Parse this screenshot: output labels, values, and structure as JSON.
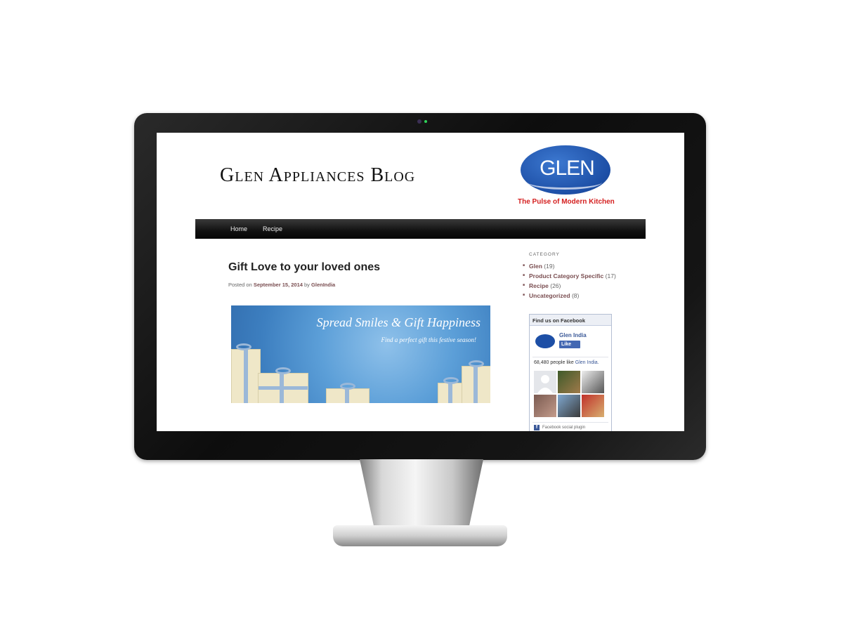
{
  "site": {
    "title": "Glen Appliances Blog",
    "logo_text": "GLEN",
    "tagline": "The Pulse of Modern Kitchen"
  },
  "nav": {
    "items": [
      {
        "label": "Home"
      },
      {
        "label": "Recipe"
      }
    ]
  },
  "post": {
    "title": "Gift Love to your loved ones",
    "meta_prefix": "Posted on",
    "date": "September 15, 2014",
    "meta_by": "by",
    "author": "GlenIndia",
    "banner": {
      "title": "Spread Smiles & Gift Happiness",
      "subtitle": "Find a perfect gift this festive season!"
    }
  },
  "sidebar": {
    "category_heading": "CATEGORY",
    "categories": [
      {
        "name": "Glen",
        "count": "(19)"
      },
      {
        "name": "Product Category Specific",
        "count": "(17)"
      },
      {
        "name": "Recipe",
        "count": "(26)"
      },
      {
        "name": "Uncategorized",
        "count": "(8)"
      }
    ],
    "facebook": {
      "heading": "Find us on Facebook",
      "page_name": "Glen India",
      "like_label": "Like",
      "count_text": "68,480 people like",
      "count_page": "Glen India.",
      "footer": "Facebook social plugin"
    }
  },
  "colors": {
    "link": "#7a4e51",
    "logo_blue": "#1d4fa6",
    "tagline_red": "#d41f1f",
    "facebook_blue": "#3b5998"
  }
}
